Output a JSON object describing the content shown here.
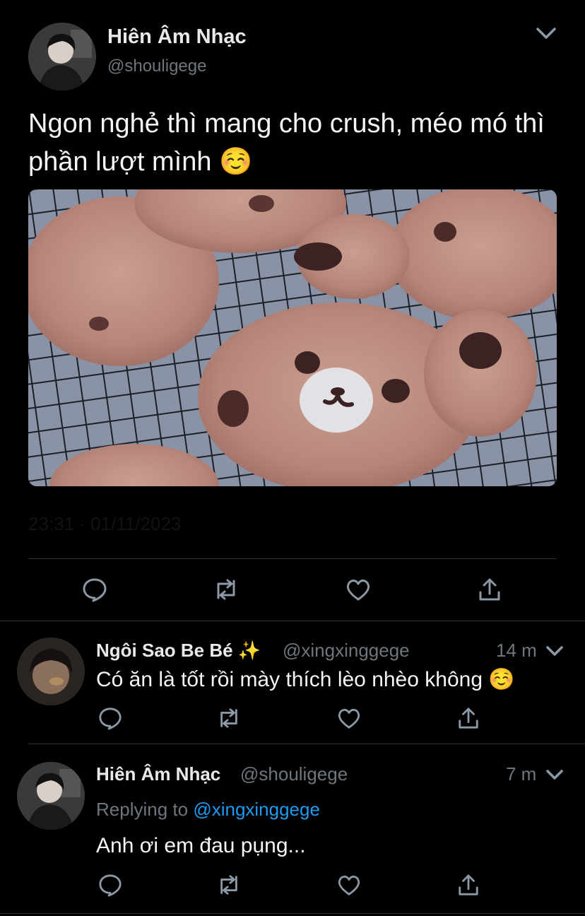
{
  "main_tweet": {
    "display_name": "Hiên Âm Nhạc",
    "handle": "@shouligege",
    "text": "Ngon nghẻ thì mang cho crush, méo mó thì phần lượt mình ☺️",
    "timestamp": "23:31 · 01/11/2023",
    "media_icon": "cookie-photo",
    "actions": [
      "reply-icon",
      "retweet-icon",
      "like-icon",
      "share-icon"
    ]
  },
  "replies": [
    {
      "display_name": "Ngôi Sao Be Bé ✨",
      "handle": "@xingxinggege",
      "time": "14 m",
      "text": "Có ăn là tốt rồi mày thích lèo nhèo không ☺️"
    },
    {
      "display_name": "Hiên Âm Nhạc",
      "handle": "@shouligege",
      "time": "7 m",
      "replying_prefix": "Replying to",
      "replying_to": "@xingxinggege",
      "text": "Anh ơi em đau pụng..."
    }
  ],
  "colors": {
    "background": "#000000",
    "text_primary": "#e7e9ea",
    "text_secondary": "#6e767d",
    "accent": "#1d9bf0",
    "divider": "#2f3336"
  }
}
